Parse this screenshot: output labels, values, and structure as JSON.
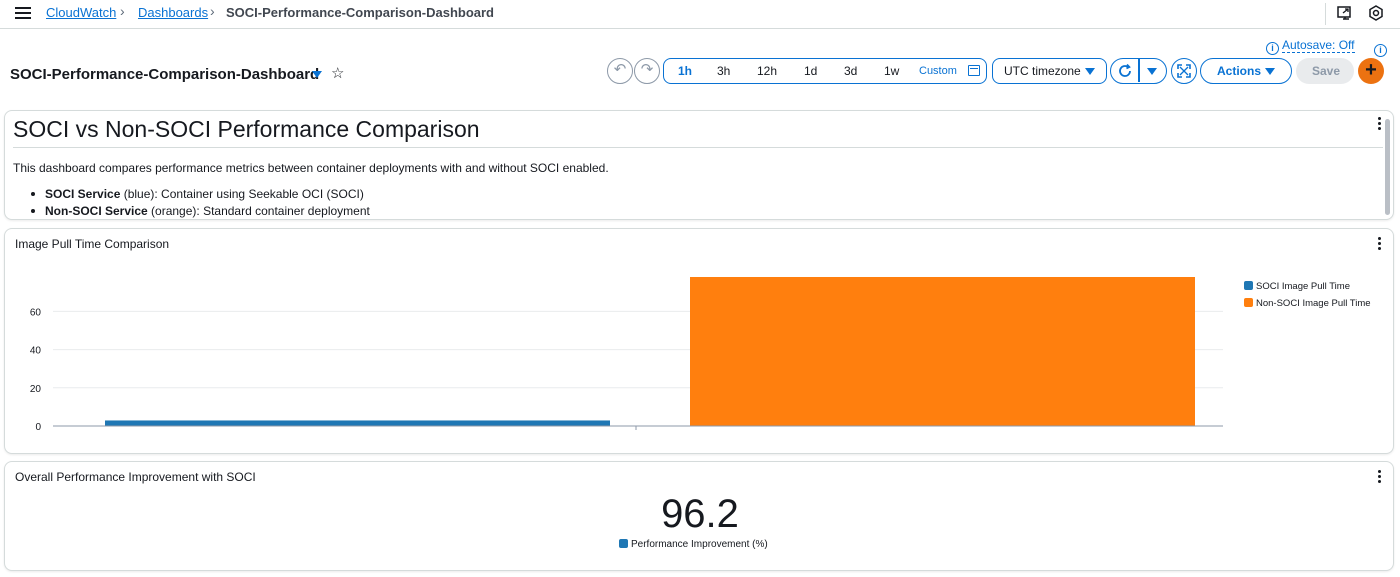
{
  "breadcrumb": {
    "items": [
      "CloudWatch",
      "Dashboards",
      "SOCI-Performance-Comparison-Dashboard"
    ]
  },
  "header": {
    "autosave_label": "Autosave: Off",
    "title": "SOCI-Performance-Comparison-Dashboard"
  },
  "toolbar": {
    "time_ranges": [
      "1h",
      "3h",
      "12h",
      "1d",
      "3d",
      "1w"
    ],
    "selected_range": "1h",
    "custom_label": "Custom",
    "timezone": "UTC timezone",
    "actions_label": "Actions",
    "save_label": "Save",
    "add_label": "+"
  },
  "text_widget": {
    "heading": "SOCI vs Non-SOCI Performance Comparison",
    "description": "This dashboard compares performance metrics between container deployments with and without SOCI enabled.",
    "bullets": [
      {
        "bold": "SOCI Service",
        "rest": " (blue): Container using Seekable OCI (SOCI)"
      },
      {
        "bold": "Non-SOCI Service",
        "rest": " (orange): Standard container deployment"
      }
    ]
  },
  "chart_widget": {
    "title": "Image Pull Time Comparison"
  },
  "number_widget": {
    "title": "Overall Performance Improvement with SOCI",
    "value": "96.2",
    "legend": "Performance Improvement (%)",
    "color": "#1f77b4"
  },
  "chart_data": {
    "type": "bar",
    "title": "Image Pull Time Comparison",
    "xlabel": "",
    "ylabel": "",
    "ylim": [
      0,
      78
    ],
    "yticks": [
      0,
      20,
      40,
      60
    ],
    "grid": true,
    "legend_position": "right",
    "series": [
      {
        "name": "SOCI Image Pull Time",
        "values": [
          2.9
        ],
        "color": "#1f77b4"
      },
      {
        "name": "Non-SOCI Image Pull Time",
        "values": [
          78
        ],
        "color": "#ff7f0e"
      }
    ]
  }
}
